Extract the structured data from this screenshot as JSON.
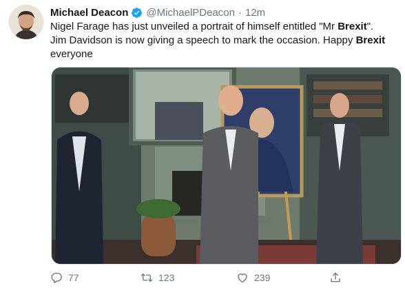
{
  "tweet": {
    "author_name": "Michael Deacon",
    "handle": "@MichaelPDeacon",
    "separator": "·",
    "timestamp": "12m",
    "text": {
      "line1_pre": "Nigel Farage has just unveiled a portrait of himself entitled \"Mr ",
      "line1_bold": "Brexit",
      "line1_post": "\".",
      "line2_pre": "Jim Davidson is now giving a speech to mark the occasion. Happy ",
      "line2_bold": "Brexit",
      "line3": "everyone"
    },
    "actions": {
      "replies": "77",
      "retweets": "123",
      "likes": "239"
    }
  },
  "icons": {
    "verified": "verified-badge-icon",
    "reply": "reply-icon",
    "retweet": "retweet-icon",
    "like": "heart-icon",
    "share": "share-icon"
  },
  "colors": {
    "verified": "#1da1f2",
    "secondary_text": "#657786",
    "primary_text": "#14171a"
  }
}
